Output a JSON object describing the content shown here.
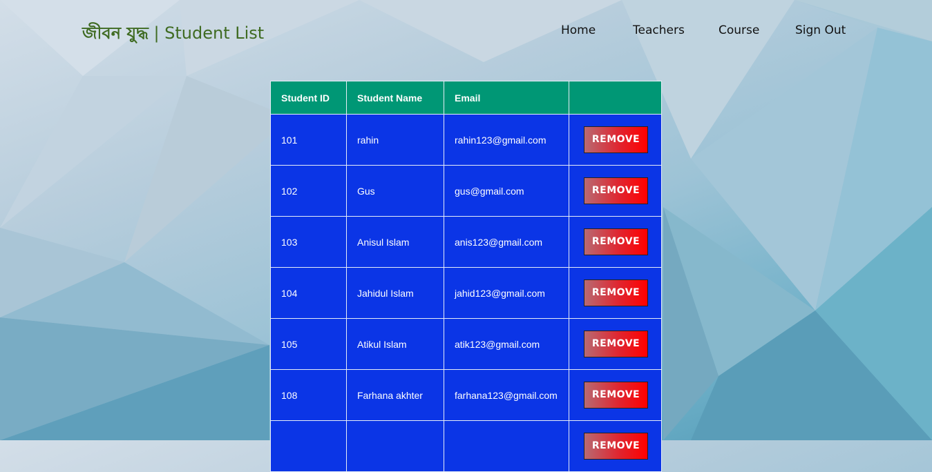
{
  "header": {
    "brand_bangla": "জীবন যুদ্ধ",
    "brand_separator": " | ",
    "brand_title": "Student List",
    "brand_color": "#3f6b22"
  },
  "nav": [
    {
      "label": "Home"
    },
    {
      "label": "Teachers"
    },
    {
      "label": "Course"
    },
    {
      "label": "Sign Out"
    }
  ],
  "table": {
    "columns": [
      "Student ID",
      "Student Name",
      "Email",
      ""
    ],
    "header_color": "#009775",
    "row_color": "#0b35e6",
    "button_label": "REMOVE",
    "rows": [
      {
        "id": "101",
        "name": "rahin",
        "email": "rahin123@gmail.com"
      },
      {
        "id": "102",
        "name": "Gus",
        "email": "gus@gmail.com"
      },
      {
        "id": "103",
        "name": "Anisul Islam",
        "email": "anis123@gmail.com"
      },
      {
        "id": "104",
        "name": "Jahidul Islam",
        "email": "jahid123@gmail.com"
      },
      {
        "id": "105",
        "name": "Atikul Islam",
        "email": "atik123@gmail.com"
      },
      {
        "id": "108",
        "name": "Farhana akhter",
        "email": "farhana123@gmail.com"
      },
      {
        "id": "",
        "name": "",
        "email": ""
      }
    ]
  }
}
